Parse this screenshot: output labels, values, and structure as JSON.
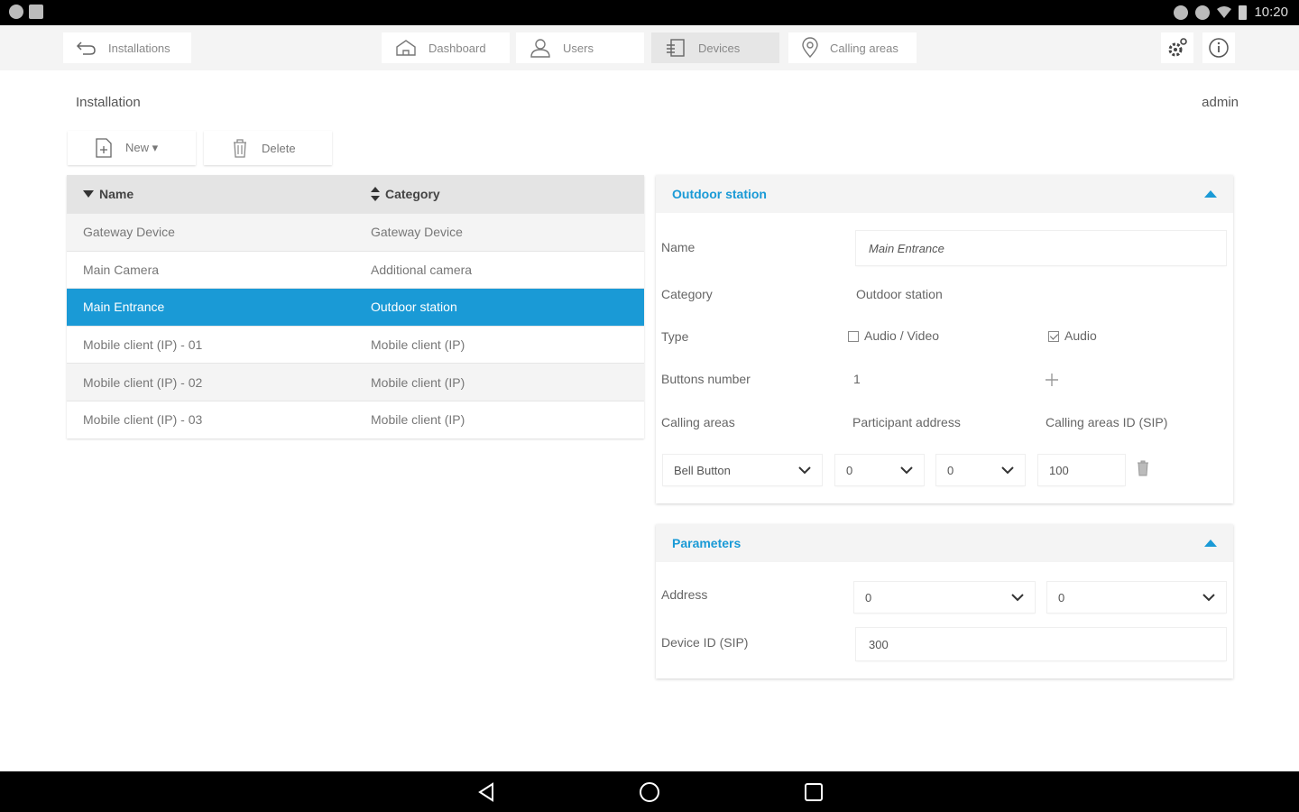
{
  "status_bar": {
    "time": "10:20"
  },
  "topbar": {
    "back_label": "Installations",
    "tabs": [
      {
        "label": "Dashboard"
      },
      {
        "label": "Users"
      },
      {
        "label": "Devices"
      },
      {
        "label": "Calling areas"
      }
    ],
    "active_tab": "Devices"
  },
  "breadcrumb": {
    "title": "Installation",
    "user": "admin"
  },
  "actions": {
    "new_label": "New ▾",
    "delete_label": "Delete"
  },
  "table": {
    "headers": {
      "name": "Name",
      "category": "Category"
    },
    "rows": [
      {
        "name": "Gateway Device",
        "category": "Gateway Device"
      },
      {
        "name": "Main Camera",
        "category": "Additional camera"
      },
      {
        "name": "Main Entrance",
        "category": "Outdoor station"
      },
      {
        "name": "Mobile client (IP) - 01",
        "category": "Mobile client (IP)"
      },
      {
        "name": "Mobile client (IP) - 02",
        "category": "Mobile client (IP)"
      },
      {
        "name": "Mobile client (IP) - 03",
        "category": "Mobile client (IP)"
      }
    ],
    "selected_index": 2
  },
  "outdoor_panel": {
    "title": "Outdoor station",
    "name_label": "Name",
    "name_value": "Main Entrance",
    "category_label": "Category",
    "category_value": "Outdoor station",
    "type_label": "Type",
    "type_option_av": "Audio / Video",
    "type_option_audio": "Audio",
    "type_av_checked": false,
    "type_audio_checked": true,
    "buttons_label": "Buttons number",
    "buttons_value": "1",
    "calling_areas_label": "Calling areas",
    "participant_address_label": "Participant address",
    "calling_areas_id_label": "Calling areas ID (SIP)",
    "row": {
      "button": "Bell Button",
      "addr1": "0",
      "addr2": "0",
      "id": "100"
    }
  },
  "parameters_panel": {
    "title": "Parameters",
    "address_label": "Address",
    "address_1": "0",
    "address_2": "0",
    "device_id_label": "Device ID (SIP)",
    "device_id_value": "300"
  },
  "colors": {
    "accent": "#1a9ad6",
    "selected_row": "#1a9ad6"
  }
}
